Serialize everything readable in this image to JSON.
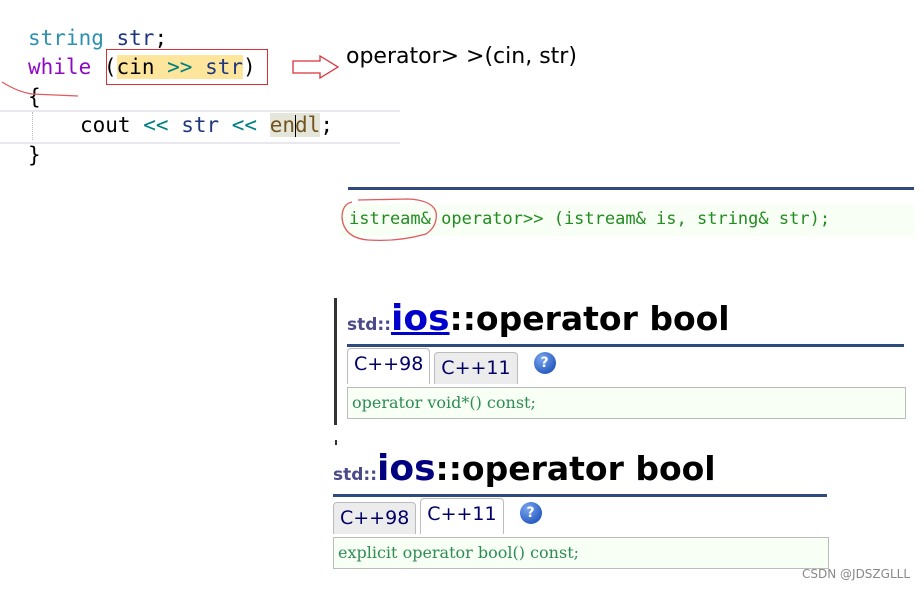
{
  "code": {
    "line1": {
      "type": "string",
      "var": "str",
      "end": ";"
    },
    "line2": {
      "keyword": "while",
      "open": "(",
      "obj": "cin",
      "op": ">>",
      "var": "str",
      "close": ")"
    },
    "line3": "{",
    "line4": {
      "obj": "cout",
      "op1": "<<",
      "var": "str",
      "op2": "<<",
      "endl_a": "en",
      "endl_b": "dl",
      "end": ";"
    },
    "line5": "}"
  },
  "annotation": {
    "arrow": "arrow-right-icon",
    "text": "operator> >(cin, str)"
  },
  "prototype": {
    "return_type": "istream&",
    "rest": " operator>> (istream& is, string& str);"
  },
  "doc_cpp98": {
    "ns": "std::",
    "cls": "ios",
    "member": "::operator bool",
    "tabs": [
      {
        "label": "C++98",
        "active": true
      },
      {
        "label": "C++11",
        "active": false
      }
    ],
    "help": "?",
    "signature": "operator void*() const;"
  },
  "doc_cpp11": {
    "ns": "std::",
    "cls": "ios",
    "member": "::operator bool",
    "tabs": [
      {
        "label": "C++98",
        "active": false
      },
      {
        "label": "C++11",
        "active": true
      }
    ],
    "help": "?",
    "signature": "explicit operator bool() const;"
  },
  "watermark": "CSDN @JDSZGLLL",
  "colors": {
    "annotation_red": "#d9313a",
    "rule_blue": "#2e4a7e",
    "proto_green": "#228b22"
  }
}
